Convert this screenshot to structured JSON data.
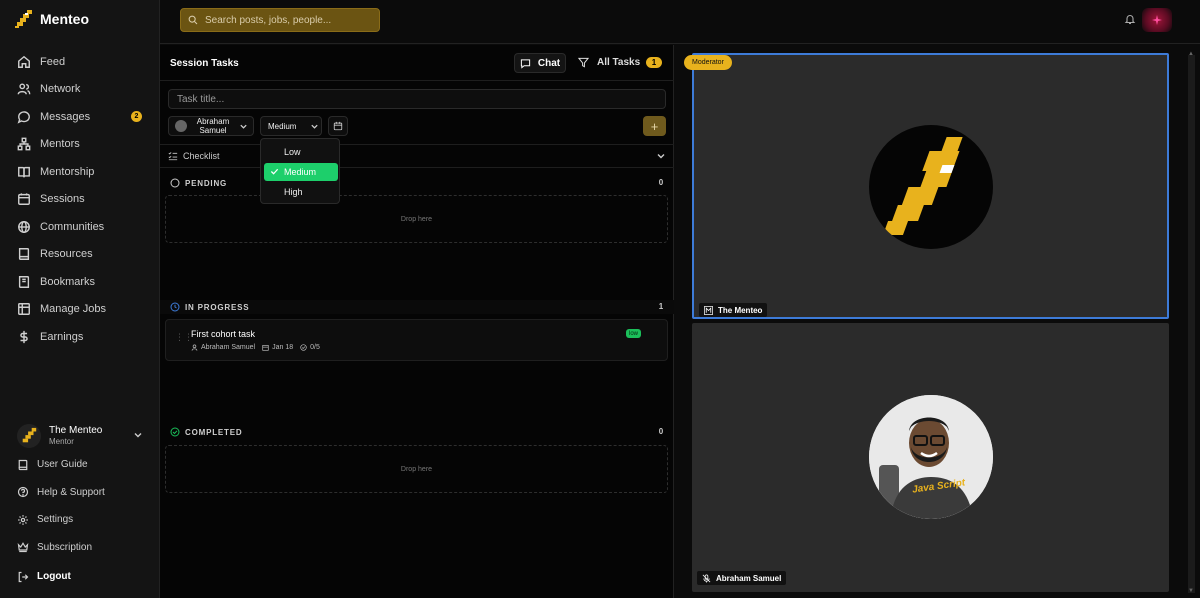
{
  "brand": {
    "name": "Menteo"
  },
  "search": {
    "placeholder": "Search posts, jobs, people..."
  },
  "sidebar": {
    "items": [
      {
        "label": "Feed",
        "icon": "home-icon"
      },
      {
        "label": "Network",
        "icon": "users-icon"
      },
      {
        "label": "Messages",
        "icon": "message-icon",
        "badge": "2"
      },
      {
        "label": "Mentors",
        "icon": "network-icon"
      },
      {
        "label": "Mentorship",
        "icon": "book-icon"
      },
      {
        "label": "Sessions",
        "icon": "calendar-icon"
      },
      {
        "label": "Communities",
        "icon": "globe-icon"
      },
      {
        "label": "Resources",
        "icon": "book-open-icon"
      },
      {
        "label": "Bookmarks",
        "icon": "bookmark-icon"
      },
      {
        "label": "Manage Jobs",
        "icon": "briefcase-icon"
      },
      {
        "label": "Earnings",
        "icon": "dollar-icon"
      }
    ],
    "profile": {
      "name": "The Menteo",
      "role": "Mentor"
    },
    "bottom": [
      {
        "label": "User Guide",
        "icon": "guide-icon"
      },
      {
        "label": "Help & Support",
        "icon": "help-icon"
      },
      {
        "label": "Settings",
        "icon": "gear-icon"
      },
      {
        "label": "Subscription",
        "icon": "crown-icon"
      }
    ],
    "logout": "Logout"
  },
  "panel": {
    "title": "Session Tasks",
    "chat_label": "Chat",
    "all_tasks_label": "All Tasks",
    "count": "1",
    "task_input_placeholder": "Task title...",
    "assignee": "Abraham Samuel",
    "priority_value": "Medium",
    "add_label": "+",
    "checklist_label": "Checklist",
    "priority_options": [
      "Low",
      "Medium",
      "High"
    ],
    "sections": {
      "pending": {
        "label": "PENDING",
        "count": "0",
        "drop": "Drop here"
      },
      "in_progress": {
        "label": "IN PROGRESS",
        "count": "1"
      },
      "completed": {
        "label": "COMPLETED",
        "count": "0",
        "drop": "Drop here"
      }
    },
    "task": {
      "title": "First cohort task",
      "assignee": "Abraham Samuel",
      "date": "Jan 18",
      "progress": "0/5",
      "priority": "low"
    }
  },
  "video": {
    "moderator_label": "Moderator",
    "tile1_name": "The Menteo",
    "tile2_name": "Abraham Samuel",
    "tile2_shirt_text": "Java Script"
  },
  "colors": {
    "accent": "#e8b21d",
    "selected": "#1dcf6b",
    "active_border": "#3d7bd8",
    "low_tag": "#1bbf5a"
  }
}
